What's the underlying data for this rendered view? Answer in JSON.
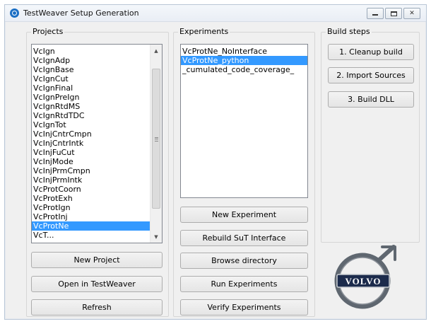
{
  "window": {
    "title": "TestWeaver Setup Generation",
    "controls": [
      "minimize",
      "maximize",
      "close"
    ]
  },
  "projects": {
    "group_label": "Projects",
    "items": [
      "VcIgn",
      "VcIgnAdp",
      "VcIgnBase",
      "VcIgnCut",
      "VcIgnFinal",
      "VcIgnPreIgn",
      "VcIgnRtdMS",
      "VcIgnRtdTDC",
      "VcIgnTot",
      "VcInjCntrCmpn",
      "VcInjCntrIntk",
      "VcInjFuCut",
      "VcInjMode",
      "VcInjPrmCmpn",
      "VcInjPrmIntk",
      "VcProtCoorn",
      "VcProtExh",
      "VcProtIgn",
      "VcProtInj",
      "VcProtNe",
      "VcT..."
    ],
    "selected_index": 19,
    "buttons": {
      "new_project": "New Project",
      "open_in_testweaver": "Open in TestWeaver",
      "refresh": "Refresh"
    }
  },
  "experiments": {
    "group_label": "Experiments",
    "items": [
      "VcProtNe_NoInterface",
      "VcProtNe_python",
      "_cumulated_code_coverage_"
    ],
    "selected_index": 1,
    "buttons": {
      "new_experiment": "New Experiment",
      "rebuild_sut_interface": "Rebuild SuT Interface",
      "browse_directory": "Browse directory",
      "run_experiments": "Run Experiments",
      "verify_experiments": "Verify Experiments"
    }
  },
  "build_steps": {
    "group_label": "Build steps",
    "buttons": {
      "cleanup_build": "1. Cleanup build",
      "import_sources": "2. Import Sources",
      "build_dll": "3. Build DLL"
    }
  },
  "logo": {
    "text": "VOLVO",
    "colors": {
      "ring": "#5f6770",
      "badge": "#1c2b4c"
    }
  }
}
